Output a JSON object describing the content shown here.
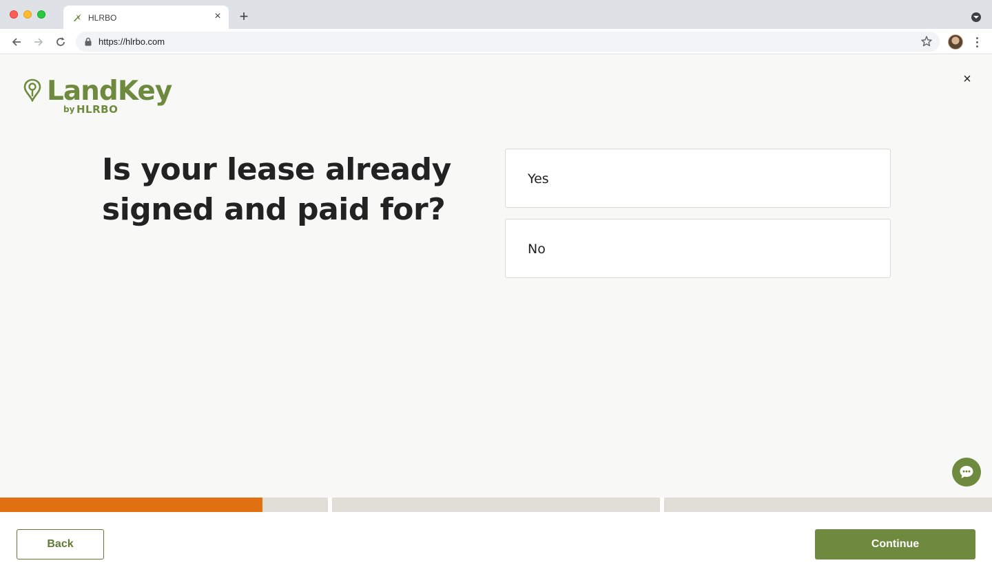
{
  "browser": {
    "tab_title": "HLRBO",
    "tab_close": "×",
    "new_tab": "+",
    "url": "https://hlrbo.com"
  },
  "brand": {
    "wordmark": "LandKey",
    "by": "by",
    "parent": "HLRBO",
    "color": "#6e8a3e"
  },
  "page": {
    "close": "×",
    "question": "Is your lease already signed and paid for?",
    "options": [
      {
        "label": "Yes"
      },
      {
        "label": "No"
      }
    ]
  },
  "progress": {
    "segments": 3,
    "current_segment_fill": 0.8,
    "fill_color": "#e07010"
  },
  "footer": {
    "back_label": "Back",
    "continue_label": "Continue"
  },
  "icons": {
    "chat": "chat-bubble-icon",
    "lock": "lock-icon",
    "star": "bookmark-star-icon"
  }
}
